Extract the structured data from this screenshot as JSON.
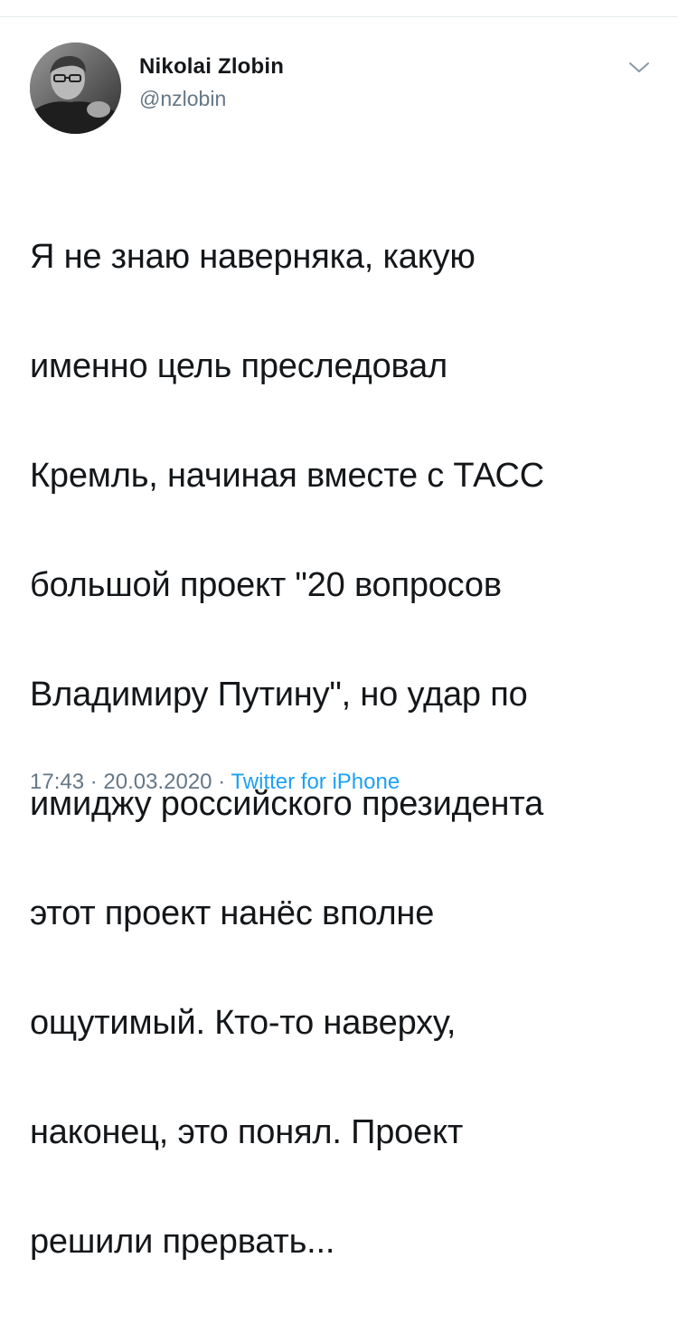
{
  "tweet": {
    "author": {
      "name": "Nikolai Zlobin",
      "handle": "@nzlobin",
      "avatar_icon": "profile-photo"
    },
    "menu_icon": "chevron-down-icon",
    "text_lines": [
      "Я не знаю наверняка, какую",
      "именно цель преследовал",
      "Кремль, начиная вместе с ТАСС",
      "большой проект \"20 вопросов",
      "Владимиру Путину\", но удар по",
      "имиджу российского президента",
      "этот проект нанёс вполне",
      "ощутимый. Кто-то наверху,",
      "наконец, это понял. Проект",
      "решили прервать..."
    ],
    "time": "17:43",
    "separator": "·",
    "date": "20.03.2020",
    "source": "Twitter for iPhone"
  },
  "colors": {
    "text": "#14171a",
    "secondary": "#657786",
    "link": "#1da1f2",
    "divider": "#e6ecf0"
  }
}
